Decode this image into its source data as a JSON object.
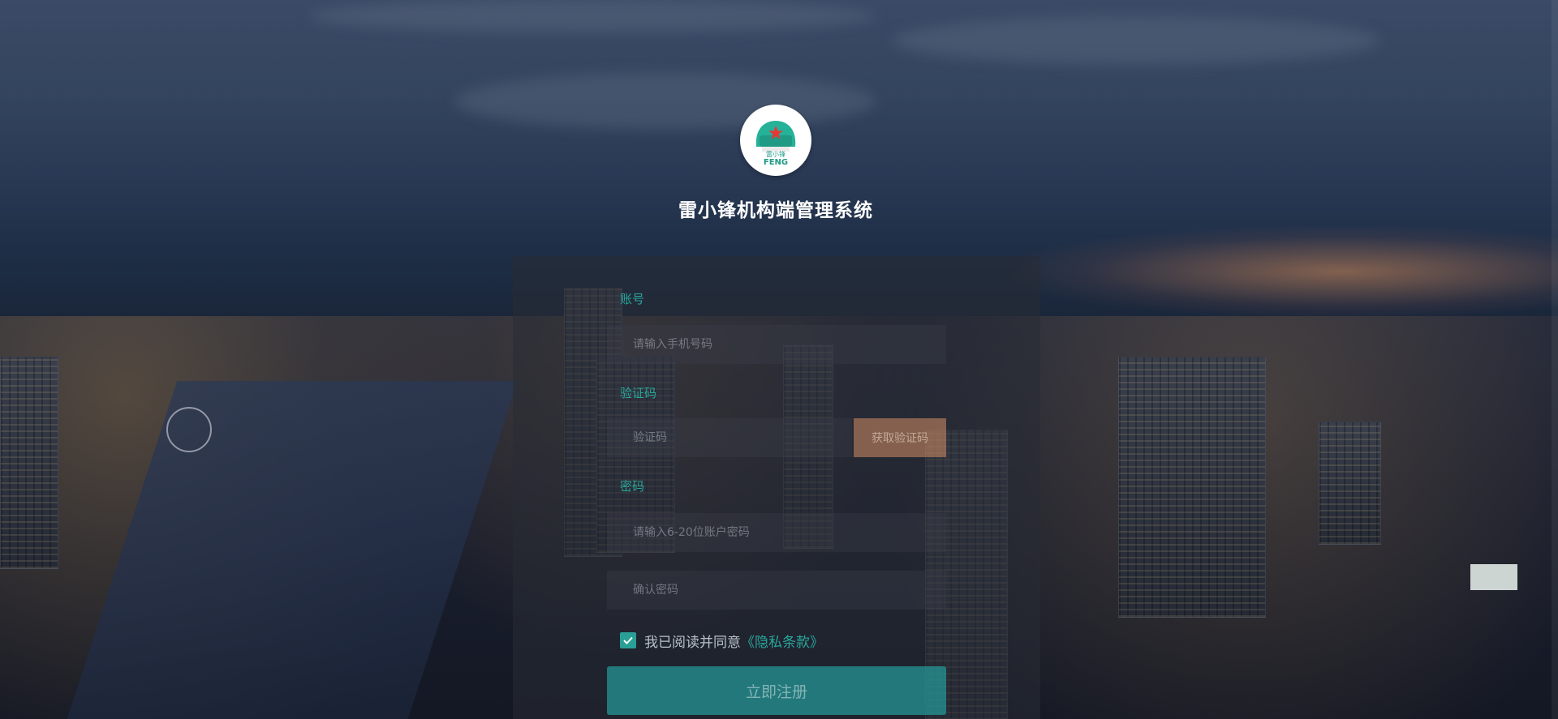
{
  "app": {
    "title": "雷小锋机构端管理系统",
    "logo_text_top": "雷小锋",
    "logo_text_bottom": "FENG"
  },
  "form": {
    "account_label": "账号",
    "account_placeholder": "请输入手机号码",
    "code_label": "验证码",
    "code_placeholder": "验证码",
    "get_code_label": "获取验证码",
    "password_label": "密码",
    "password_placeholder": "请输入6-20位账户密码",
    "confirm_placeholder": "确认密码",
    "agree_text": "我已阅读并同意",
    "privacy_link": "《隐私条款》",
    "agree_checked": true,
    "submit_label": "立即注册"
  },
  "colors": {
    "accent": "#2aa79b",
    "code_button": "#d68e64",
    "submit": "#269696"
  }
}
